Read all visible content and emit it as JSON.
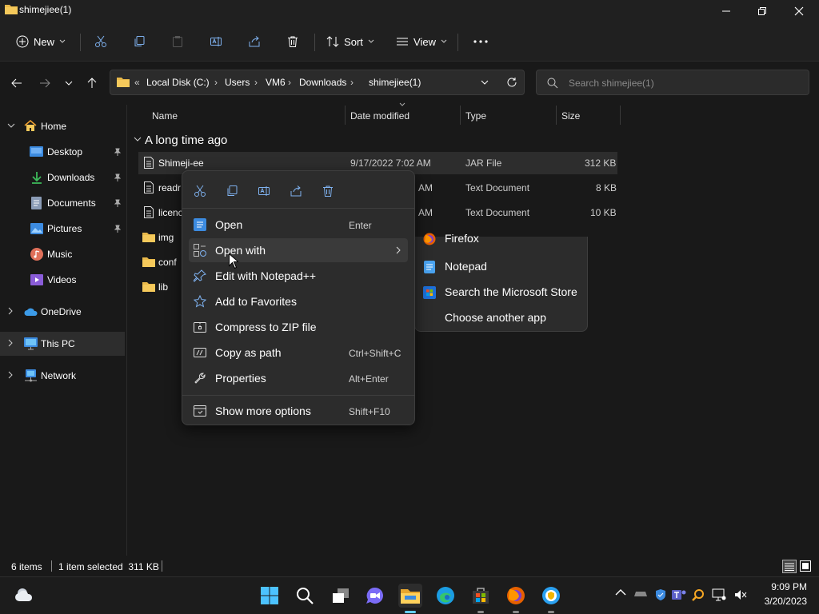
{
  "window": {
    "title": "shimejiee(1)"
  },
  "toolbar": {
    "new_label": "New",
    "sort_label": "Sort",
    "view_label": "View"
  },
  "address": {
    "crumbs": [
      "Local Disk (C:)",
      "Users",
      "VM6",
      "Downloads",
      "shimejiee(1)"
    ]
  },
  "search": {
    "placeholder": "Search shimejiee(1)"
  },
  "sidebar": {
    "items": [
      {
        "label": "Home"
      },
      {
        "label": "Desktop"
      },
      {
        "label": "Downloads"
      },
      {
        "label": "Documents"
      },
      {
        "label": "Pictures"
      },
      {
        "label": "Music"
      },
      {
        "label": "Videos"
      },
      {
        "label": "OneDrive"
      },
      {
        "label": "This PC"
      },
      {
        "label": "Network"
      }
    ]
  },
  "columns": {
    "name": "Name",
    "date": "Date modified",
    "type": "Type",
    "size": "Size"
  },
  "group": {
    "label": "A long time ago"
  },
  "files": [
    {
      "name": "Shimeji-ee",
      "date": "9/17/2022 7:02 AM",
      "type": "JAR File",
      "size": "312 KB"
    },
    {
      "name": "readr",
      "date": "AM",
      "type": "Text Document",
      "size": "8 KB"
    },
    {
      "name": "licenc",
      "date": "AM",
      "type": "Text Document",
      "size": "10 KB"
    },
    {
      "name": "img",
      "date": "",
      "type": "",
      "size": ""
    },
    {
      "name": "conf",
      "date": "",
      "type": "",
      "size": ""
    },
    {
      "name": "lib",
      "date": "",
      "type": "",
      "size": ""
    }
  ],
  "context_menu": {
    "items": [
      {
        "label": "Open",
        "shortcut": "Enter"
      },
      {
        "label": "Open with",
        "shortcut": ""
      },
      {
        "label": "Edit with Notepad++",
        "shortcut": ""
      },
      {
        "label": "Add to Favorites",
        "shortcut": ""
      },
      {
        "label": "Compress to ZIP file",
        "shortcut": ""
      },
      {
        "label": "Copy as path",
        "shortcut": "Ctrl+Shift+C"
      },
      {
        "label": "Properties",
        "shortcut": "Alt+Enter"
      },
      {
        "label": "Show more options",
        "shortcut": "Shift+F10"
      }
    ]
  },
  "submenu": {
    "items": [
      "Firefox",
      "Notepad",
      "Search the Microsoft Store",
      "Choose another app"
    ]
  },
  "status": {
    "items_count": "6 items",
    "selection": "1 item selected  311 KB"
  },
  "taskbar": {
    "time": "9:09 PM",
    "date": "3/20/2023"
  },
  "colors": {
    "accent": "#ffc83d",
    "folder": "#e8b84a",
    "background": "#191919"
  }
}
